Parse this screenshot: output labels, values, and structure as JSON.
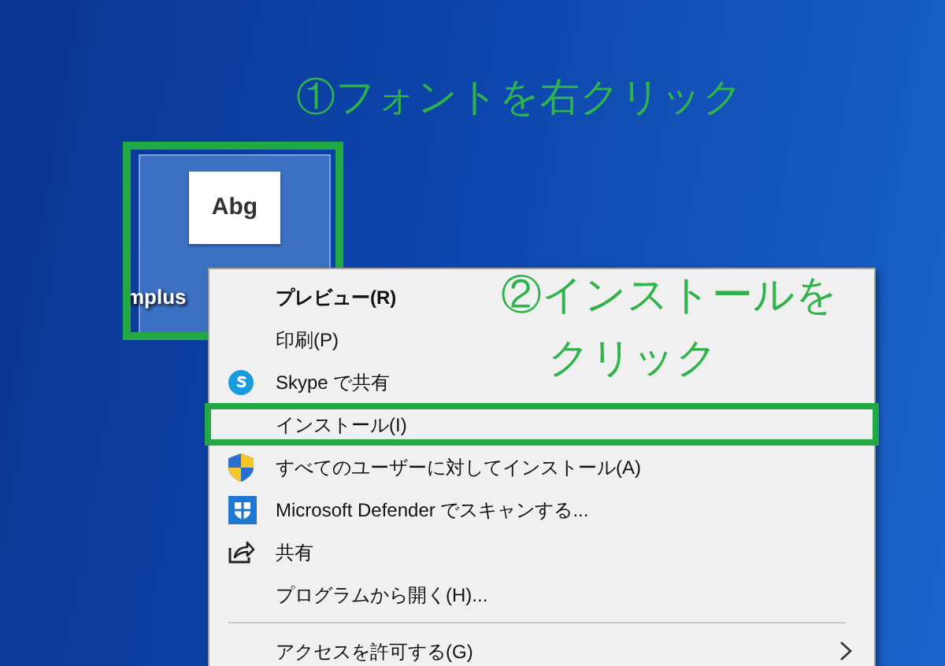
{
  "annotations": [
    {
      "text": "①フォントを右クリック"
    },
    {
      "text": "②インストールを"
    },
    {
      "text": "クリック"
    }
  ],
  "desktop_icon": {
    "label": "mplus",
    "preview": "Abg",
    "selected": true,
    "highlighted": true
  },
  "context_menu": {
    "items": [
      {
        "kind": "default",
        "label": "プレビュー(R)",
        "highlighted": false
      },
      {
        "kind": "plain",
        "label": "印刷(P)",
        "highlighted": false
      },
      {
        "kind": "skype",
        "label": "Skype で共有",
        "highlighted": false
      },
      {
        "kind": "plain",
        "label": "インストール(I)",
        "highlighted": true
      },
      {
        "kind": "uac",
        "label": "すべてのユーザーに対してインストール(A)",
        "highlighted": false
      },
      {
        "kind": "defender",
        "label": "Microsoft Defender でスキャンする...",
        "highlighted": false
      },
      {
        "kind": "share",
        "label": "共有",
        "highlighted": false
      },
      {
        "kind": "plain",
        "label": "プログラムから開く(H)...",
        "highlighted": false
      },
      {
        "kind": "separator"
      },
      {
        "kind": "submenu",
        "label": "アクセスを許可する(G)",
        "highlighted": false
      }
    ]
  }
}
